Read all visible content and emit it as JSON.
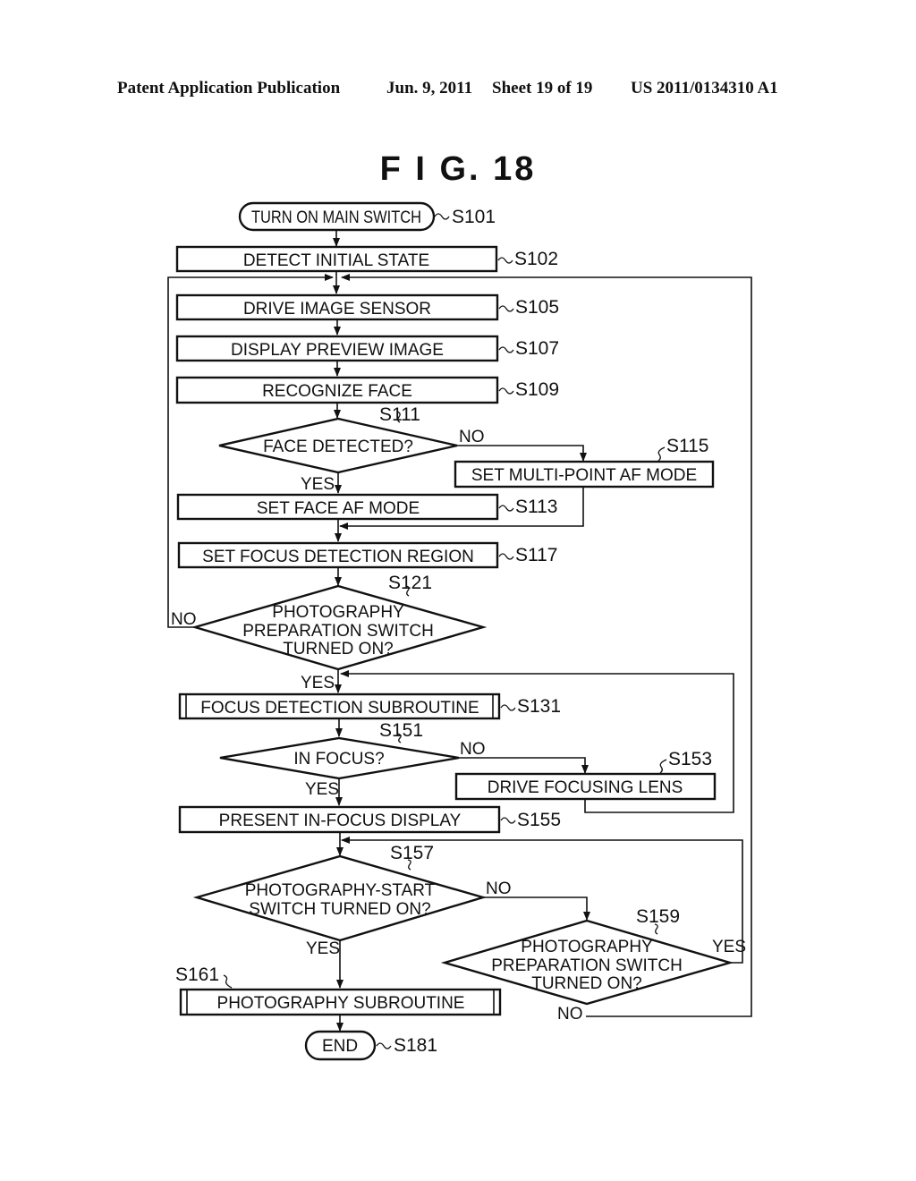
{
  "header": {
    "publication": "Patent Application Publication",
    "date": "Jun. 9, 2011",
    "sheet": "Sheet 19 of 19",
    "number": "US 2011/0134310 A1"
  },
  "figure": {
    "title": "F I G.  18"
  },
  "nodes": {
    "s101": {
      "step": "S101",
      "type": "terminal",
      "lines": [
        "TURN ON MAIN SWITCH"
      ]
    },
    "s102": {
      "step": "S102",
      "type": "process",
      "lines": [
        "DETECT INITIAL STATE"
      ]
    },
    "s105": {
      "step": "S105",
      "type": "process",
      "lines": [
        "DRIVE IMAGE SENSOR"
      ]
    },
    "s107": {
      "step": "S107",
      "type": "process",
      "lines": [
        "DISPLAY PREVIEW IMAGE"
      ]
    },
    "s109": {
      "step": "S109",
      "type": "process",
      "lines": [
        "RECOGNIZE FACE"
      ]
    },
    "s111": {
      "step": "S111",
      "type": "decision",
      "lines": [
        "FACE DETECTED?"
      ]
    },
    "s113": {
      "step": "S113",
      "type": "process",
      "lines": [
        "SET FACE AF MODE"
      ]
    },
    "s115": {
      "step": "S115",
      "type": "process",
      "lines": [
        "SET MULTI-POINT AF MODE"
      ]
    },
    "s117": {
      "step": "S117",
      "type": "process",
      "lines": [
        "SET FOCUS DETECTION REGION"
      ]
    },
    "s121": {
      "step": "S121",
      "type": "decision",
      "lines": [
        "PHOTOGRAPHY",
        "PREPARATION SWITCH",
        "TURNED ON?"
      ]
    },
    "s131": {
      "step": "S131",
      "type": "subroutine",
      "lines": [
        "FOCUS DETECTION SUBROUTINE"
      ]
    },
    "s151": {
      "step": "S151",
      "type": "decision",
      "lines": [
        "IN FOCUS?"
      ]
    },
    "s153": {
      "step": "S153",
      "type": "process",
      "lines": [
        "DRIVE FOCUSING LENS"
      ]
    },
    "s155": {
      "step": "S155",
      "type": "process",
      "lines": [
        "PRESENT IN-FOCUS DISPLAY"
      ]
    },
    "s157": {
      "step": "S157",
      "type": "decision",
      "lines": [
        "PHOTOGRAPHY-START",
        "SWITCH TURNED ON?"
      ]
    },
    "s159": {
      "step": "S159",
      "type": "decision",
      "lines": [
        "PHOTOGRAPHY",
        "PREPARATION SWITCH",
        "TURNED ON?"
      ]
    },
    "s161": {
      "step": "S161",
      "type": "subroutine",
      "lines": [
        "PHOTOGRAPHY SUBROUTINE"
      ]
    },
    "s181": {
      "step": "S181",
      "type": "terminal",
      "lines": [
        "END"
      ]
    }
  },
  "edges": [
    {
      "from": "s101",
      "to": "s102",
      "label": ""
    },
    {
      "from": "s102",
      "to": "s105",
      "label": ""
    },
    {
      "from": "s105",
      "to": "s107",
      "label": ""
    },
    {
      "from": "s107",
      "to": "s109",
      "label": ""
    },
    {
      "from": "s109",
      "to": "s111",
      "label": ""
    },
    {
      "from": "s111",
      "to": "s113",
      "label": "YES"
    },
    {
      "from": "s111",
      "to": "s115",
      "label": "NO"
    },
    {
      "from": "s113",
      "to": "s117",
      "label": ""
    },
    {
      "from": "s115",
      "to": "s117",
      "label": ""
    },
    {
      "from": "s117",
      "to": "s121",
      "label": ""
    },
    {
      "from": "s121",
      "to": "s131",
      "label": "YES"
    },
    {
      "from": "s121",
      "to": "s105",
      "label": "NO"
    },
    {
      "from": "s131",
      "to": "s151",
      "label": ""
    },
    {
      "from": "s151",
      "to": "s155",
      "label": "YES"
    },
    {
      "from": "s151",
      "to": "s153",
      "label": "NO"
    },
    {
      "from": "s153",
      "to": "s131",
      "label": ""
    },
    {
      "from": "s155",
      "to": "s157",
      "label": ""
    },
    {
      "from": "s157",
      "to": "s161",
      "label": "YES"
    },
    {
      "from": "s157",
      "to": "s159",
      "label": "NO"
    },
    {
      "from": "s159",
      "to": "s157",
      "label": "YES"
    },
    {
      "from": "s159",
      "to": "s105",
      "label": "NO"
    },
    {
      "from": "s161",
      "to": "s181",
      "label": ""
    }
  ],
  "edge_labels": {
    "yes": "YES",
    "no": "NO"
  }
}
